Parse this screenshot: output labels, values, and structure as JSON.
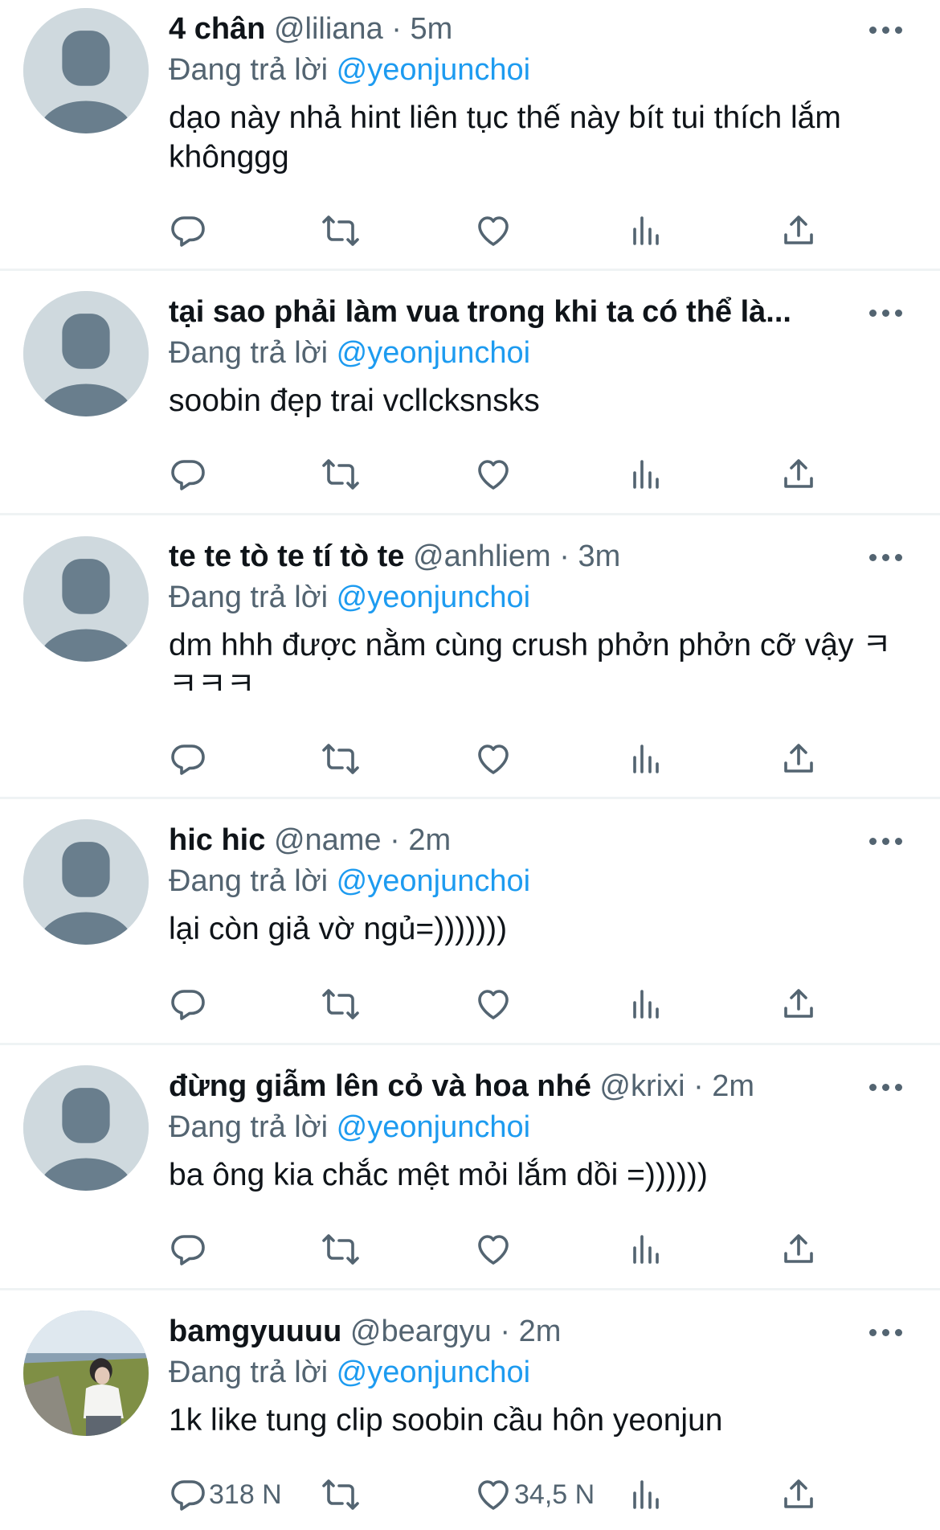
{
  "colors": {
    "accent": "#1d9bf0",
    "secondary_text": "#536471",
    "avatar_placeholder": "#cfd9de"
  },
  "tweets": [
    {
      "name": "4 chân",
      "handle": "@liliana",
      "time": "5m",
      "reply_prefix": "Đang trả lời",
      "reply_to": "@yeonjunchoi",
      "text": "dạo này nhả hint liên tục thế này bít tui thích lắm khônggg",
      "avatar": "default-avatar",
      "replies": "",
      "likes": ""
    },
    {
      "name": "tại sao phải làm vua trong khi ta có thể là...",
      "handle": "",
      "time": "",
      "reply_prefix": "Đang trả lời",
      "reply_to": "@yeonjunchoi",
      "text": "soobin đẹp trai vcllcksnsks",
      "avatar": "default-avatar",
      "replies": "",
      "likes": ""
    },
    {
      "name": "te te tò te tí tò te",
      "handle": "@anhliem",
      "time": "3m",
      "reply_prefix": "Đang trả lời",
      "reply_to": "@yeonjunchoi",
      "text": "dm hhh được nằm cùng crush phởn phởn cỡ vậy ㅋㅋㅋㅋ",
      "avatar": "default-avatar",
      "replies": "",
      "likes": ""
    },
    {
      "name": "hic hic",
      "handle": "@name",
      "time": "2m",
      "reply_prefix": "Đang trả lời",
      "reply_to": "@yeonjunchoi",
      "text": "lại còn giả vờ ngủ=)))))))",
      "avatar": "default-avatar",
      "replies": "",
      "likes": ""
    },
    {
      "name": "đừng giẫm lên cỏ và hoa nhé",
      "handle": "@krixi",
      "time": "2m",
      "reply_prefix": "Đang trả lời",
      "reply_to": "@yeonjunchoi",
      "text": "ba ông kia chắc mệt mỏi lắm dồi =))))))",
      "avatar": "default-avatar",
      "replies": "",
      "likes": ""
    },
    {
      "name": "bamgyuuuu",
      "handle": "@beargyu",
      "time": "2m",
      "reply_prefix": "Đang trả lời",
      "reply_to": "@yeonjunchoi",
      "text": "1k like tung clip soobin cầu hôn yeonjun",
      "avatar": "photo-avatar",
      "replies": "318 N",
      "likes": "34,5 N"
    }
  ],
  "icons": [
    "reply-icon",
    "retweet-icon",
    "like-icon",
    "analytics-icon",
    "share-icon",
    "more-icon"
  ]
}
